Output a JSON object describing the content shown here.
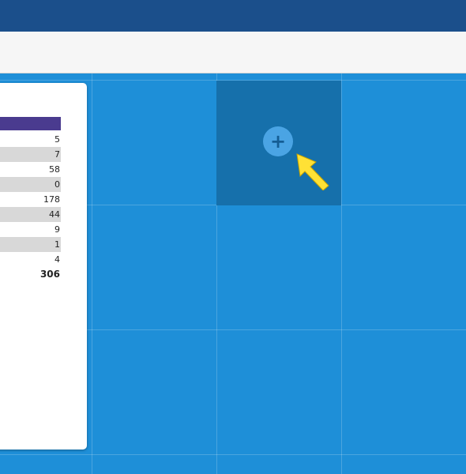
{
  "table": {
    "rows": [
      {
        "value": "5",
        "shaded": false
      },
      {
        "value": "7",
        "shaded": true
      },
      {
        "value": "58",
        "shaded": false
      },
      {
        "value": "0",
        "shaded": true
      },
      {
        "value": "178",
        "shaded": false
      },
      {
        "value": "44",
        "shaded": true
      },
      {
        "value": "9",
        "shaded": false
      },
      {
        "value": "1",
        "shaded": true
      },
      {
        "value": "4",
        "shaded": false
      }
    ],
    "total": "306"
  },
  "add_button": {
    "icon": "plus-icon",
    "glyph": "+"
  },
  "cursor": {
    "icon": "arrow-cursor-icon",
    "color": "#ffe135"
  },
  "colors": {
    "topbar": "#1b4f8b",
    "dashboard": "#1e8fd8",
    "hover_cell": "#1670ab",
    "table_header": "#4a3b8f"
  }
}
